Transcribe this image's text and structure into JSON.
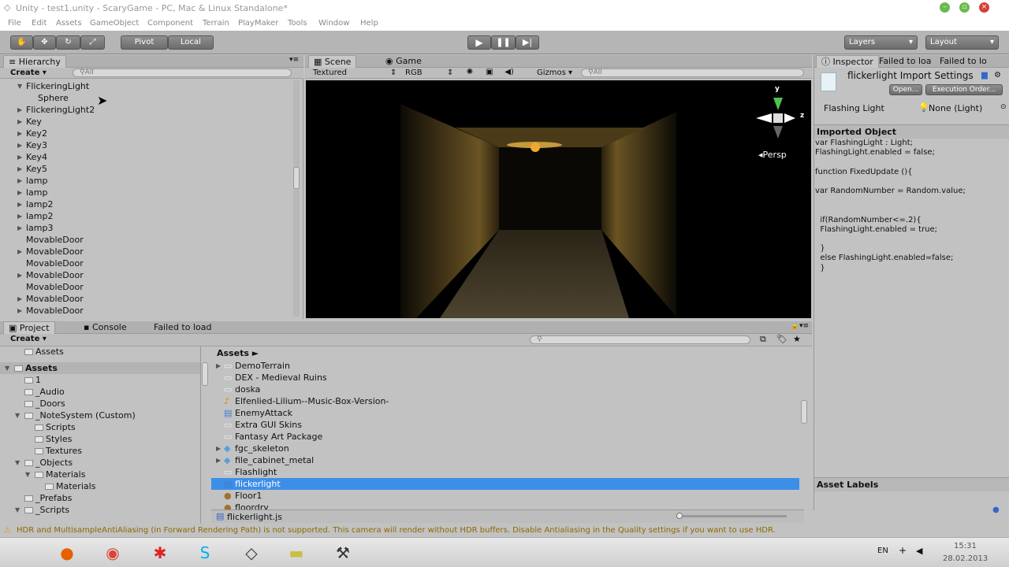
{
  "window": {
    "title": "Unity - test1.unity - ScaryGame - PC, Mac & Linux Standalone*",
    "app_icon": "unity-icon"
  },
  "menu": [
    "File",
    "Edit",
    "Assets",
    "GameObject",
    "Component",
    "Terrain",
    "PlayMaker",
    "Tools",
    "Window",
    "Help"
  ],
  "toolbar": {
    "pivot": "Pivot",
    "local": "Local",
    "layers": "Layers",
    "layout": "Layout"
  },
  "hierarchy": {
    "tab": "Hierarchy",
    "create": "Create",
    "search_placeholder": "All",
    "items": [
      {
        "label": "FlickeringLight",
        "expanded": true,
        "indent": 0
      },
      {
        "label": "Sphere",
        "indent": 1
      },
      {
        "label": "FlickeringLight2",
        "arrow": true,
        "indent": 0
      },
      {
        "label": "Key",
        "arrow": true,
        "indent": 0
      },
      {
        "label": "Key2",
        "arrow": true,
        "indent": 0
      },
      {
        "label": "Key3",
        "arrow": true,
        "indent": 0
      },
      {
        "label": "Key4",
        "arrow": true,
        "indent": 0
      },
      {
        "label": "Key5",
        "arrow": true,
        "indent": 0
      },
      {
        "label": "lamp",
        "arrow": true,
        "indent": 0
      },
      {
        "label": "lamp",
        "arrow": true,
        "indent": 0
      },
      {
        "label": "lamp2",
        "arrow": true,
        "indent": 0
      },
      {
        "label": "lamp2",
        "arrow": true,
        "indent": 0
      },
      {
        "label": "lamp3",
        "arrow": true,
        "indent": 0
      },
      {
        "label": "MovableDoor",
        "indent": 0
      },
      {
        "label": "MovableDoor",
        "arrow": true,
        "indent": 0
      },
      {
        "label": "MovableDoor",
        "indent": 0
      },
      {
        "label": "MovableDoor",
        "arrow": true,
        "indent": 0
      },
      {
        "label": "MovableDoor",
        "indent": 0
      },
      {
        "label": "MovableDoor",
        "arrow": true,
        "indent": 0
      },
      {
        "label": "MovableDoor",
        "arrow": true,
        "indent": 0
      }
    ]
  },
  "scene": {
    "tab_scene": "Scene",
    "tab_game": "Game",
    "mode": "Textured",
    "color": "RGB",
    "gizmos": "Gizmos",
    "search_placeholder": "All",
    "persp": "Persp",
    "axis_y": "y",
    "axis_z": "z"
  },
  "inspector": {
    "tab": "Inspector",
    "tab2": "Failed to loa",
    "tab3": "Failed to lo",
    "title": "flickerlight Import Settings",
    "open": "Open...",
    "exec": "Execution Order...",
    "prop_label": "Flashing Light",
    "prop_value": "None (Light)",
    "imported": "Imported Object",
    "asset_labels": "Asset Labels",
    "code": [
      "var FlashingLight : Light;",
      "FlashingLight.enabled = false;",
      "",
      "function FixedUpdate (){",
      "",
      "var RandomNumber = Random.value;",
      "",
      "",
      "  if(RandomNumber<=.2){",
      "  FlashingLight.enabled = true;",
      "",
      "  }",
      "  else FlashingLight.enabled=false;",
      "  }"
    ]
  },
  "project": {
    "tab": "Project",
    "console": "Console",
    "failed": "Failed to load",
    "create": "Create",
    "tree": [
      {
        "label": "Assets",
        "indent": 1,
        "partial": true
      },
      {
        "label": "Assets",
        "indent": 0,
        "bold": true,
        "expanded": true
      },
      {
        "label": "1",
        "indent": 1
      },
      {
        "label": "_Audio",
        "indent": 1
      },
      {
        "label": "_Doors",
        "indent": 1
      },
      {
        "label": "_NoteSystem (Custom)",
        "indent": 1,
        "expanded": true
      },
      {
        "label": "Scripts",
        "indent": 2
      },
      {
        "label": "Styles",
        "indent": 2
      },
      {
        "label": "Textures",
        "indent": 2
      },
      {
        "label": "_Objects",
        "indent": 1,
        "expanded": true
      },
      {
        "label": "Materials",
        "indent": 2,
        "expanded": true
      },
      {
        "label": "Materials",
        "indent": 3
      },
      {
        "label": "_Prefabs",
        "indent": 1
      },
      {
        "label": "_Scripts",
        "indent": 1,
        "expanded": true
      }
    ],
    "breadcrumb": "Assets ►",
    "assets": [
      {
        "label": "DemoTerrain",
        "arrow": true,
        "icon": "folder"
      },
      {
        "label": "DEX - Medieval Ruins",
        "icon": "folder"
      },
      {
        "label": "doska",
        "icon": "folder"
      },
      {
        "label": "Elfenlied-Lilium--Music-Box-Version-",
        "icon": "audio"
      },
      {
        "label": "EnemyAttack",
        "icon": "script"
      },
      {
        "label": "Extra GUI Skins",
        "icon": "folder"
      },
      {
        "label": "Fantasy Art Package",
        "icon": "folder"
      },
      {
        "label": "fgc_skeleton",
        "arrow": true,
        "icon": "model"
      },
      {
        "label": "file_cabinet_metal",
        "arrow": true,
        "icon": "model"
      },
      {
        "label": "Flashlight",
        "icon": "folder"
      },
      {
        "label": "flickerlight",
        "icon": "script",
        "selected": true
      },
      {
        "label": "Floor1",
        "icon": "material"
      },
      {
        "label": "floordry",
        "icon": "material"
      }
    ],
    "footer_file": "flickerlight.js"
  },
  "status": "HDR and MultisampleAntiAliasing (in Forward Rendering Path) is not supported. This camera will render without HDR buffers. Disable Antialiasing in the Quality settings if you want to use HDR.",
  "taskbar": {
    "lang": "EN",
    "time": "15:31",
    "date": "28.02.2013"
  }
}
